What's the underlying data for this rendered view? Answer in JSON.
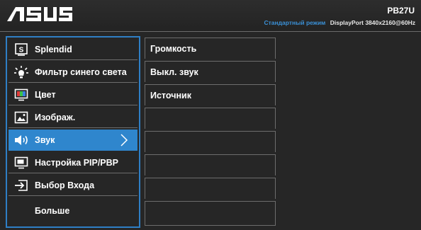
{
  "header": {
    "model": "PB27U",
    "mode": "Стандартный режим",
    "input_info": "DisplayPort  3840x2160@60Hz"
  },
  "menu": {
    "items": [
      {
        "label": "Splendid",
        "icon": "splendid-icon"
      },
      {
        "label": "Фильтр синего света",
        "icon": "bluelight-filter-icon"
      },
      {
        "label": "Цвет",
        "icon": "color-icon"
      },
      {
        "label": "Изображ.",
        "icon": "image-icon"
      },
      {
        "label": "Звук",
        "icon": "speaker-icon",
        "active": true
      },
      {
        "label": "Настройка PIP/PBP",
        "icon": "pip-icon"
      },
      {
        "label": "Выбор Входа",
        "icon": "input-select-icon"
      },
      {
        "label": "Больше",
        "icon": ""
      }
    ]
  },
  "submenu": {
    "items": [
      {
        "label": "Громкость"
      },
      {
        "label": "Выкл. звук"
      },
      {
        "label": "Источник"
      },
      {
        "label": ""
      },
      {
        "label": ""
      },
      {
        "label": ""
      },
      {
        "label": ""
      },
      {
        "label": ""
      }
    ]
  },
  "colors": {
    "accent": "#2f86cd",
    "mode_text": "#3a90d6",
    "background": "#262626"
  }
}
